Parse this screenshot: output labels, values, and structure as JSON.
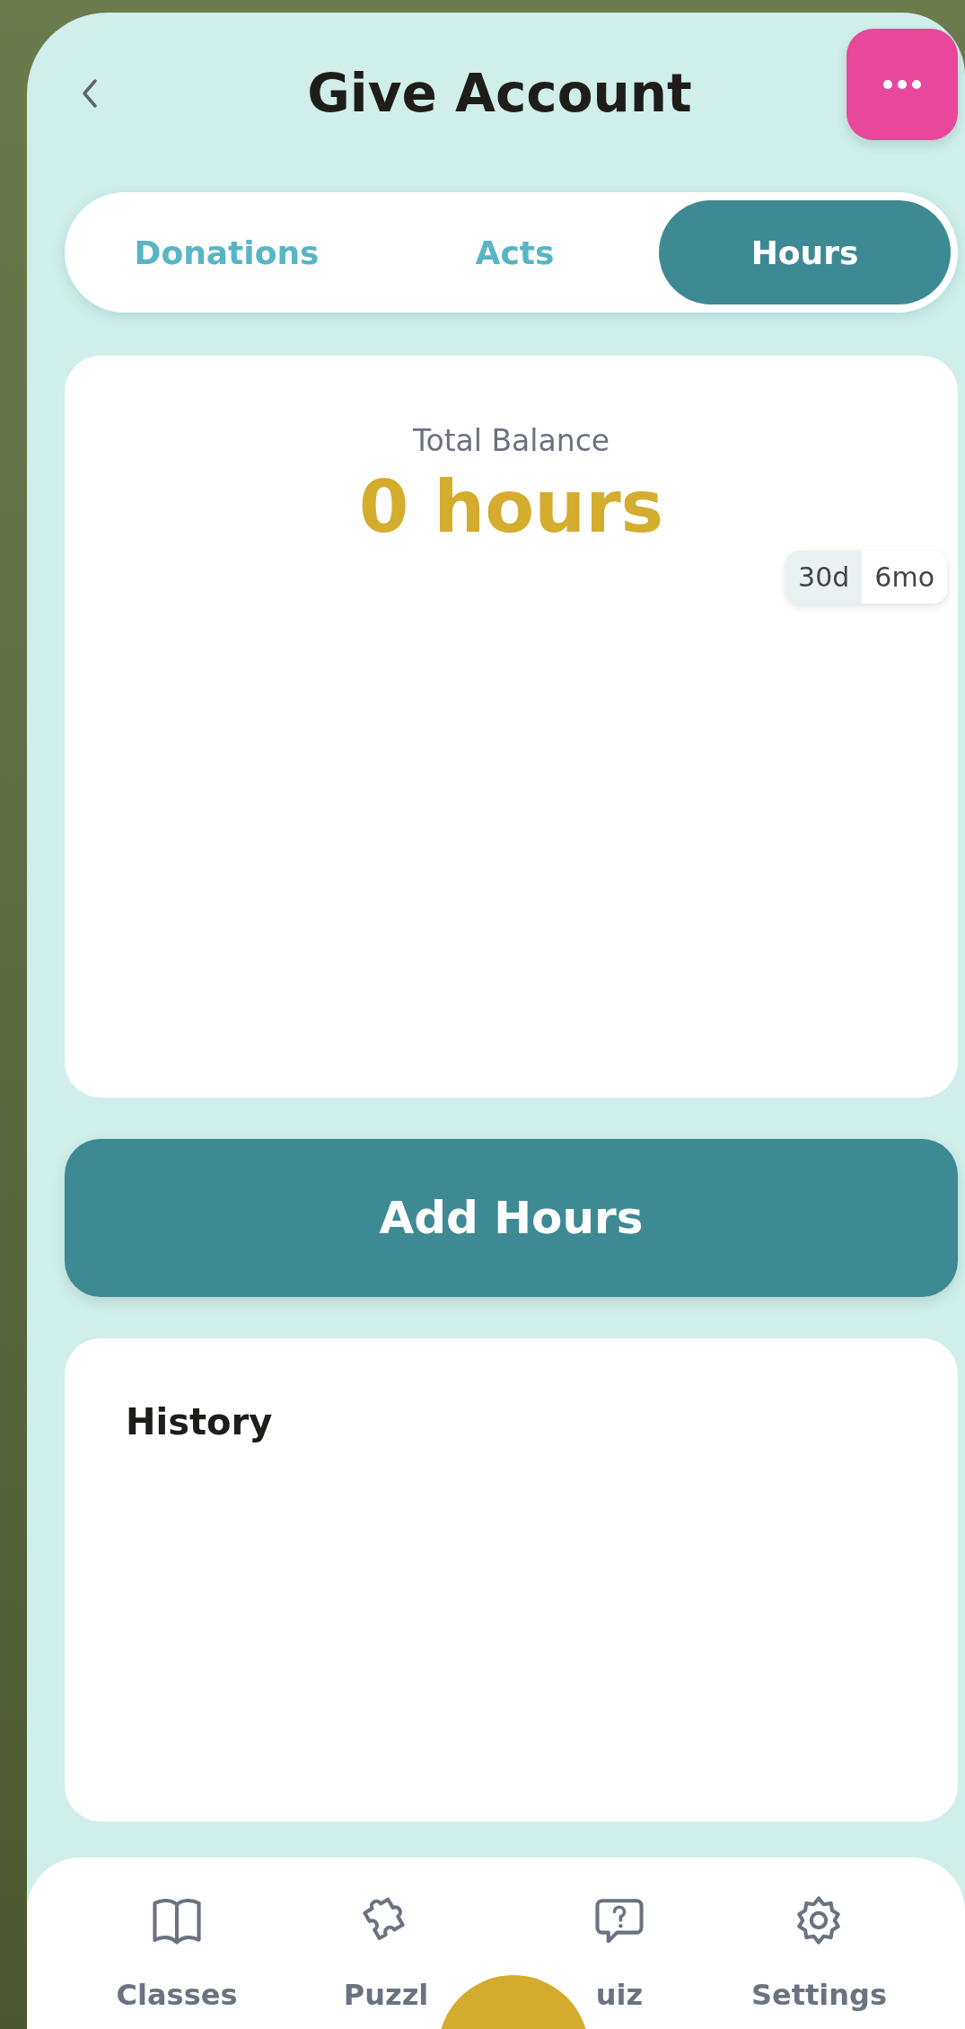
{
  "header": {
    "title": "Give Account"
  },
  "tabs": [
    {
      "label": "Donations",
      "selected": false
    },
    {
      "label": "Acts",
      "selected": false
    },
    {
      "label": "Hours",
      "selected": true
    }
  ],
  "balance": {
    "label": "Total Balance",
    "value": "0 hours",
    "ranges": [
      {
        "label": "30d",
        "selected": true
      },
      {
        "label": "6mo",
        "selected": false
      }
    ]
  },
  "add_button": "Add Hours",
  "history": {
    "title": "History"
  },
  "nav": [
    {
      "label": "Classes"
    },
    {
      "label": "Puzzl"
    },
    {
      "label": "uiz"
    },
    {
      "label": "Settings"
    }
  ]
}
